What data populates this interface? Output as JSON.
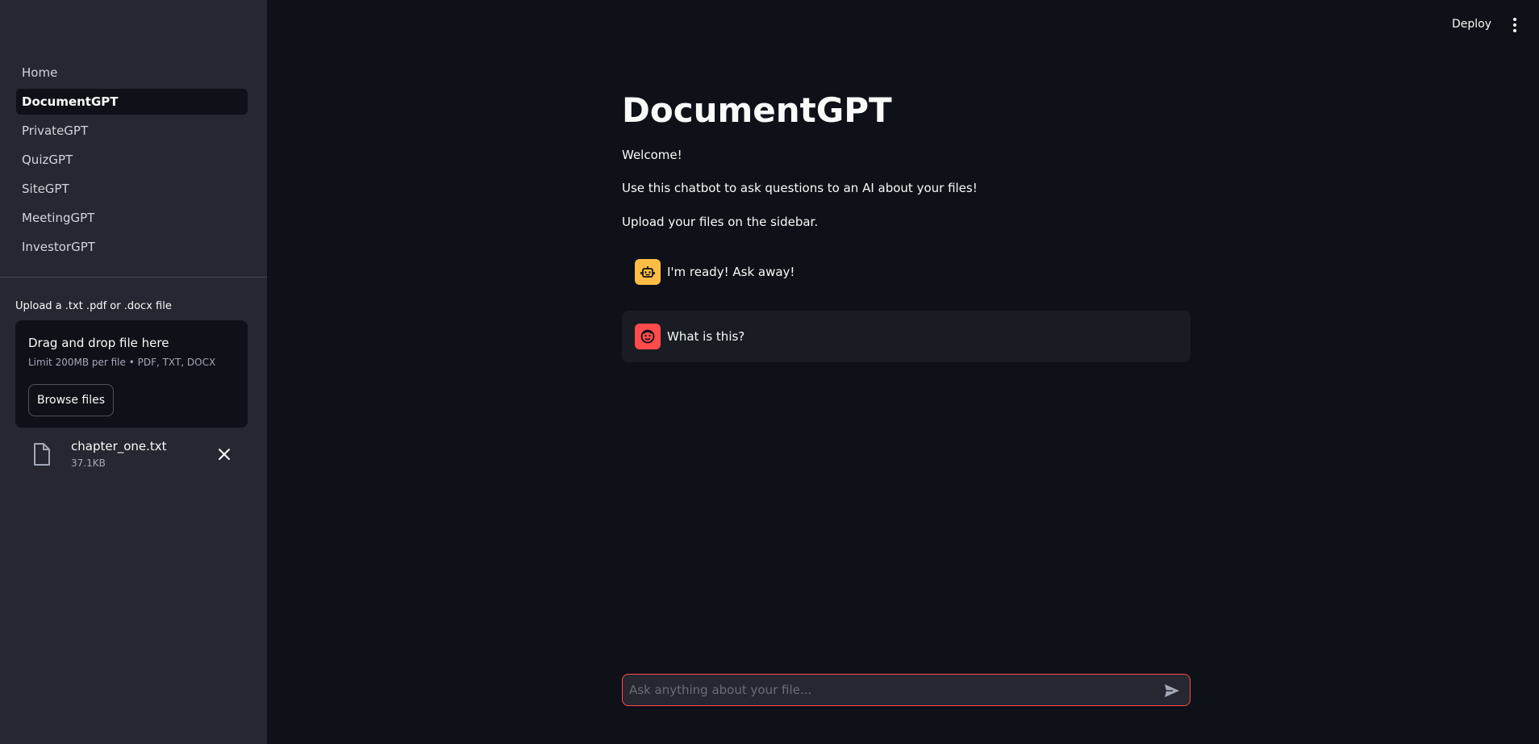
{
  "header": {
    "deploy_label": "Deploy"
  },
  "sidebar": {
    "nav": [
      {
        "label": "Home"
      },
      {
        "label": "DocumentGPT"
      },
      {
        "label": "PrivateGPT"
      },
      {
        "label": "QuizGPT"
      },
      {
        "label": "SiteGPT"
      },
      {
        "label": "MeetingGPT"
      },
      {
        "label": "InvestorGPT"
      }
    ],
    "active_index": 1,
    "uploader": {
      "label": "Upload a .txt .pdf or .docx file",
      "drop_title": "Drag and drop file here",
      "limit": "Limit 200MB per file • PDF, TXT, DOCX",
      "browse_label": "Browse files"
    },
    "file": {
      "name": "chapter_one.txt",
      "size": "37.1KB",
      "icon": "file-icon",
      "remove_icon": "close-icon"
    }
  },
  "main": {
    "title": "DocumentGPT",
    "welcome": "Welcome!",
    "intro": "Use this chatbot to ask questions to an AI about your files!",
    "hint": "Upload your files on the sidebar.",
    "messages": [
      {
        "role": "ai",
        "text": "I'm ready! Ask away!",
        "avatar": "robot-icon",
        "color": "#ffbd45"
      },
      {
        "role": "human",
        "text": "What is this?",
        "avatar": "smile-icon",
        "color": "#ff4b4b"
      }
    ],
    "chat_input": {
      "placeholder": "Ask anything about your file...",
      "value": ""
    }
  },
  "colors": {
    "accent": "#ff4b4b",
    "background": "#0e1117",
    "sidebar": "#262730"
  }
}
